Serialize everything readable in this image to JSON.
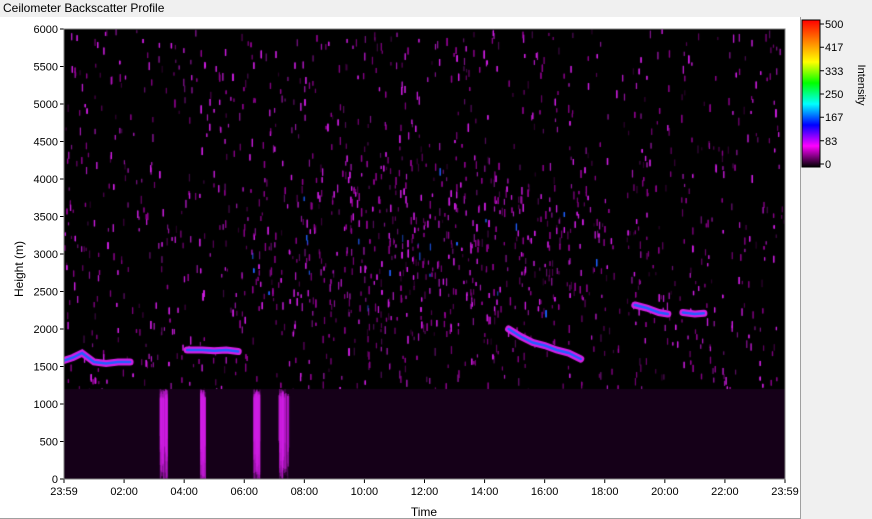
{
  "window": {
    "title": "Ceilometer Backscatter Profile"
  },
  "colors": {
    "plot_background": "#000000",
    "signal_low": "#8b008b",
    "signal_mid": "#d21ee6",
    "signal_high": "#2060ff",
    "panel": "#f0f0f0"
  },
  "chart_data": {
    "type": "heatmap",
    "title": "",
    "xlabel": "Time",
    "ylabel": "Height (m)",
    "x_ticks": [
      "23:59",
      "02:00",
      "04:00",
      "06:00",
      "08:00",
      "10:00",
      "12:00",
      "14:00",
      "16:00",
      "18:00",
      "20:00",
      "22:00",
      "23:59"
    ],
    "y_ticks": [
      0,
      500,
      1000,
      1500,
      2000,
      2500,
      3000,
      3500,
      4000,
      4500,
      5000,
      5500,
      6000
    ],
    "xlim_hours": [
      0,
      24
    ],
    "ylim": [
      0,
      6000
    ],
    "grid": false,
    "colorbar": {
      "label": "Intensity",
      "ticks": [
        500,
        417,
        333,
        250,
        167,
        83,
        0
      ],
      "range": [
        0,
        500
      ],
      "colors": [
        "#000000",
        "#ff00ff",
        "#0000ff",
        "#00ffff",
        "#00ff00",
        "#ffff00",
        "#ff8000",
        "#ff0000"
      ]
    },
    "layer_traces": [
      {
        "hours": [
          0.0,
          0.3,
          0.6,
          1.0,
          1.4,
          1.8,
          2.2
        ],
        "height_m": [
          1580,
          1620,
          1680,
          1560,
          1540,
          1560,
          1560
        ]
      },
      {
        "hours": [
          4.1,
          4.6,
          5.0,
          5.4,
          5.8
        ],
        "height_m": [
          1720,
          1720,
          1710,
          1720,
          1700
        ]
      },
      {
        "hours": [
          14.8,
          15.2,
          15.6,
          16.0,
          16.4,
          16.8,
          17.2
        ],
        "height_m": [
          2000,
          1900,
          1820,
          1780,
          1720,
          1680,
          1600
        ]
      },
      {
        "hours": [
          19.0,
          19.4,
          19.8,
          20.1
        ],
        "height_m": [
          2320,
          2280,
          2220,
          2200
        ]
      },
      {
        "hours": [
          20.6,
          21.0,
          21.3
        ],
        "height_m": [
          2220,
          2200,
          2210
        ]
      }
    ],
    "aerosol_regions": [
      {
        "hours": [
          6.0,
          18.0
        ],
        "height_m": [
          1800,
          4200
        ],
        "intensity": 90
      }
    ]
  }
}
